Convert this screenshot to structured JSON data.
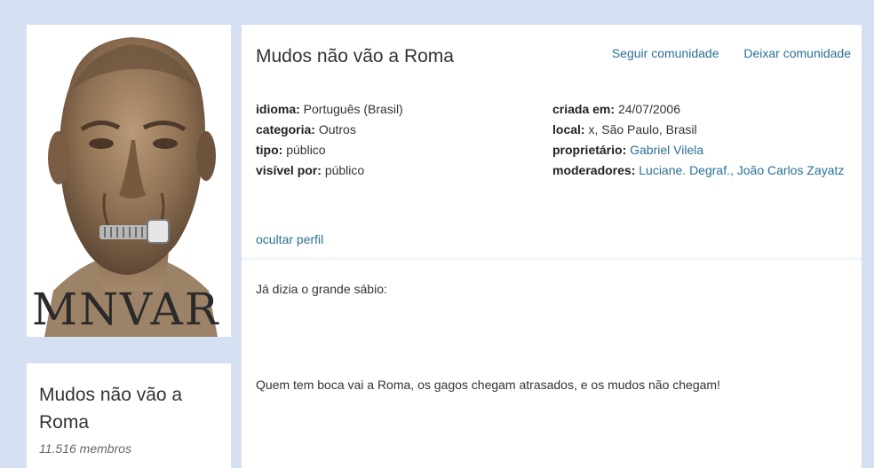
{
  "community": {
    "name": "Mudos não vão a Roma",
    "members": "11.516 membros",
    "photo_caption": "MNVAR"
  },
  "header": {
    "title": "Mudos não vão a Roma",
    "follow_link": "Seguir comunidade",
    "leave_link": "Deixar comunidade"
  },
  "info": {
    "language_label": "idioma:",
    "language_value": "Português (Brasil)",
    "category_label": "categoria:",
    "category_value": "Outros",
    "type_label": "tipo:",
    "type_value": "público",
    "visible_label": "visível por:",
    "visible_value": "público",
    "created_label": "criada em:",
    "created_value": "24/07/2006",
    "location_label": "local:",
    "location_value": "x, São Paulo, Brasil",
    "owner_label": "proprietário:",
    "owner_value": "Gabriel Vilela",
    "moderators_label": "moderadores:",
    "moderators_value": "Luciane. Degraf., João Carlos Zayatz"
  },
  "hide_profile_link": "ocultar perfil",
  "description": {
    "line1": "Já dizia o grande sábio:",
    "line2": "Quem tem boca vai a Roma, os gagos chegam atrasados, e os mudos não chegam!"
  },
  "colors": {
    "page_background": "#d5e1f2",
    "link": "#2a7094",
    "card_background": "#ffffff"
  }
}
